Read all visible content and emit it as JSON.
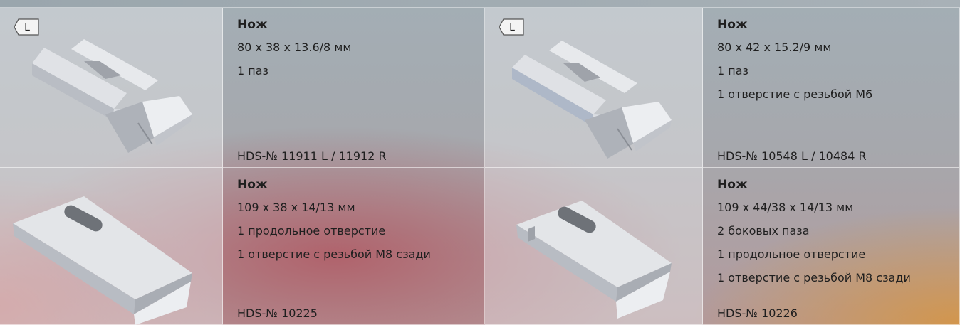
{
  "products": [
    {
      "title": "Нож",
      "lines": [
        "80 x 38 x 13.6/8 мм",
        "1 паз"
      ],
      "article": "HDS-№ 11911 L / 11912 R",
      "badge": "L",
      "image_icon": "slotted-knife-icon"
    },
    {
      "title": "Нож",
      "lines": [
        "80 x 42 x 15.2/9 мм",
        "1 паз",
        "1 отверстие с резьбой М6"
      ],
      "article": "HDS-№ 10548 L / 10484 R",
      "badge": "L",
      "image_icon": "slotted-knife-icon"
    },
    {
      "title": "Нож",
      "lines": [
        "109 x 38 x 14/13 мм",
        "1 продольное отверстие",
        "1 отверстие с резьбой М8 сзади"
      ],
      "article": "HDS-№ 10225",
      "image_icon": "long-hole-knife-icon"
    },
    {
      "title": "Нож",
      "lines": [
        "109 x 44/38 x 14/13 мм",
        "2 боковых паза",
        "1 продольное отверстие",
        "1 отверстие с резьбой М8 сзади"
      ],
      "article": "HDS-№ 10226",
      "image_icon": "side-groove-knife-icon"
    }
  ]
}
